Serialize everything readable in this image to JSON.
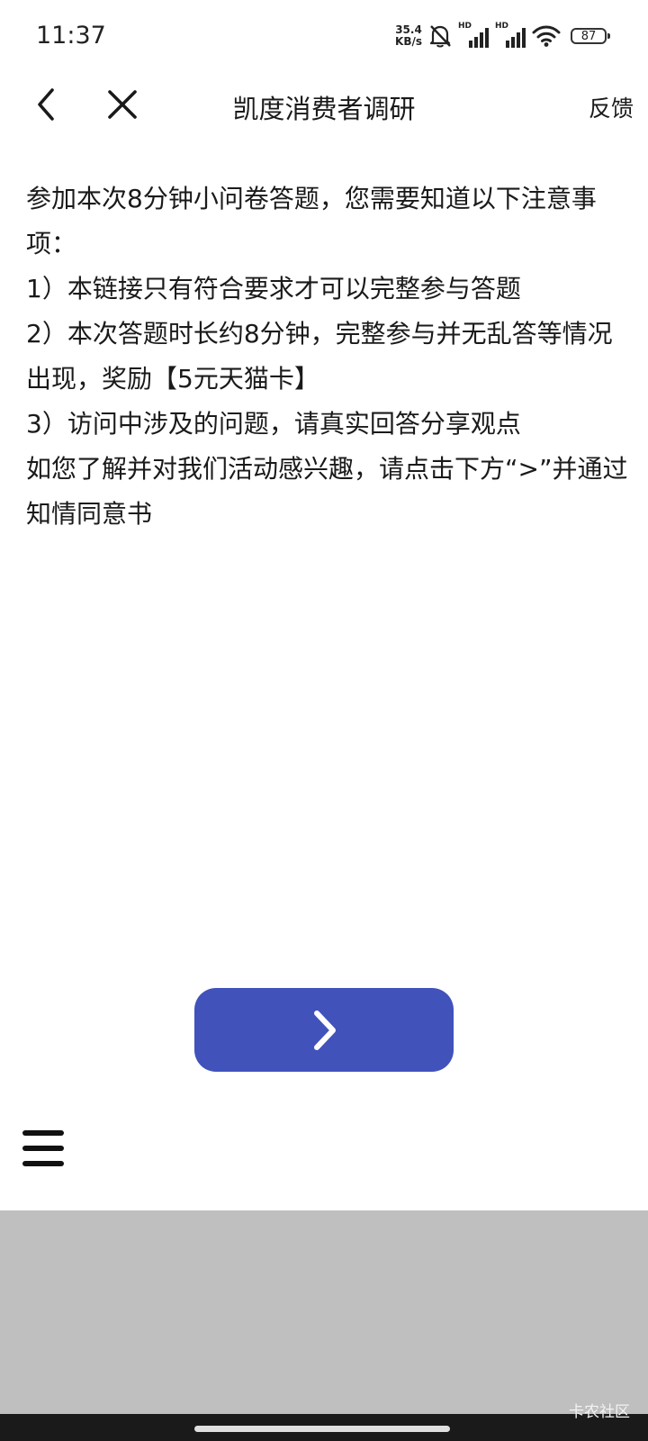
{
  "status_bar": {
    "time": "11:37",
    "net_speed_value": "35.4",
    "net_speed_unit": "KB/s",
    "sim1_label": "HD",
    "sim2_label": "HD",
    "battery": "87"
  },
  "nav": {
    "title": "凯度消费者调研",
    "feedback": "反馈"
  },
  "content": {
    "lines": [
      "参加本次8分钟小问卷答题，您需要知道以下注意事项：",
      "1）本链接只有符合要求才可以完整参与答题",
      "2）本次答题时长约8分钟，完整参与并无乱答等情况出现，奖励【5元天猫卡】",
      "3）访问中涉及的问题，请真实回答分享观点",
      "如您了解并对我们活动感兴趣，请点击下方“>”并通过知情同意书"
    ]
  },
  "next_button": {
    "icon": "chevron-right-icon",
    "color": "#4152bb"
  },
  "watermark": "卡农社区"
}
